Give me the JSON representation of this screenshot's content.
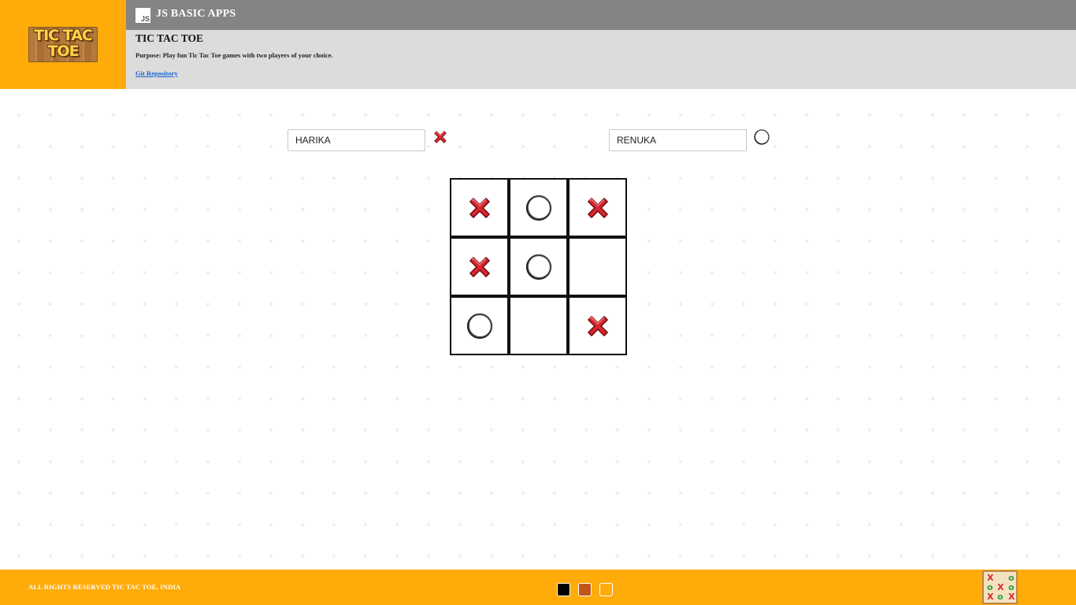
{
  "header": {
    "logo_lines": [
      "TIC TAC",
      "TOE"
    ],
    "brand_icon_text": "JS",
    "brand": "JS BASIC APPS",
    "app_title": "TIC TAC TOE",
    "purpose": "Purpose: Play fun Tic Tac Toe games with two players of your choice.",
    "repo_link": "Git Repository"
  },
  "players": [
    {
      "name": "HARIKA",
      "mark": "x-icon"
    },
    {
      "name": "RENUKA",
      "mark": "o-icon"
    }
  ],
  "board": [
    [
      "X",
      "O",
      "X"
    ],
    [
      "X",
      "O",
      ""
    ],
    [
      "O",
      "",
      "X"
    ]
  ],
  "footer": {
    "copyright": "ALL RIGHTS RESERVED TIC TAC TOE, INDIA",
    "theme_swatches": [
      "#000000",
      "#c0561b",
      "#ffab0a"
    ]
  },
  "colors": {
    "accent": "#ffab0a",
    "topbar": "#848484",
    "infobar": "#dcdcdc",
    "x_mark": "#d9272e",
    "link": "#1a66d6"
  }
}
